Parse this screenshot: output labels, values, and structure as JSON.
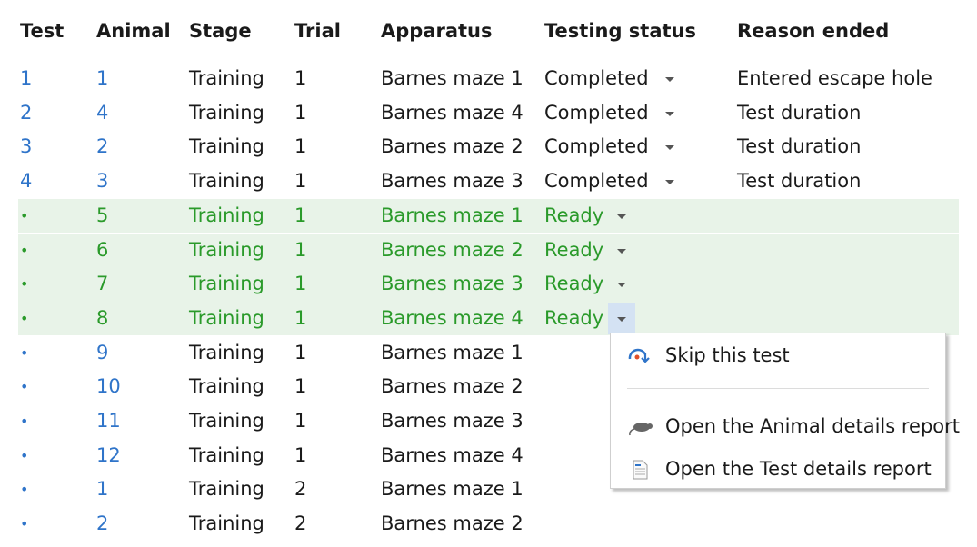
{
  "columns": [
    "Test",
    "Animal",
    "Stage",
    "Trial",
    "Apparatus",
    "Testing status",
    "Reason ended"
  ],
  "rows": [
    {
      "test": "1",
      "animal": "1",
      "stage": "Training",
      "trial": "1",
      "apparatus": "Barnes maze 1",
      "status": "Completed",
      "reason": "Entered escape hole",
      "state": "completed"
    },
    {
      "test": "2",
      "animal": "4",
      "stage": "Training",
      "trial": "1",
      "apparatus": "Barnes maze 4",
      "status": "Completed",
      "reason": "Test duration",
      "state": "completed"
    },
    {
      "test": "3",
      "animal": "2",
      "stage": "Training",
      "trial": "1",
      "apparatus": "Barnes maze 2",
      "status": "Completed",
      "reason": "Test duration",
      "state": "completed"
    },
    {
      "test": "4",
      "animal": "3",
      "stage": "Training",
      "trial": "1",
      "apparatus": "Barnes maze 3",
      "status": "Completed",
      "reason": "Test duration",
      "state": "completed"
    },
    {
      "test": "•",
      "animal": "5",
      "stage": "Training",
      "trial": "1",
      "apparatus": "Barnes maze 1",
      "status": "Ready",
      "reason": "",
      "state": "ready"
    },
    {
      "test": "•",
      "animal": "6",
      "stage": "Training",
      "trial": "1",
      "apparatus": "Barnes maze 2",
      "status": "Ready",
      "reason": "",
      "state": "ready"
    },
    {
      "test": "•",
      "animal": "7",
      "stage": "Training",
      "trial": "1",
      "apparatus": "Barnes maze 3",
      "status": "Ready",
      "reason": "",
      "state": "ready"
    },
    {
      "test": "•",
      "animal": "8",
      "stage": "Training",
      "trial": "1",
      "apparatus": "Barnes maze 4",
      "status": "Ready",
      "reason": "",
      "state": "ready",
      "menu_open": true
    },
    {
      "test": "•",
      "animal": "9",
      "stage": "Training",
      "trial": "1",
      "apparatus": "Barnes maze 1",
      "status": "",
      "reason": "",
      "state": "pending"
    },
    {
      "test": "•",
      "animal": "10",
      "stage": "Training",
      "trial": "1",
      "apparatus": "Barnes maze 2",
      "status": "",
      "reason": "",
      "state": "pending"
    },
    {
      "test": "•",
      "animal": "11",
      "stage": "Training",
      "trial": "1",
      "apparatus": "Barnes maze 3",
      "status": "",
      "reason": "",
      "state": "pending"
    },
    {
      "test": "•",
      "animal": "12",
      "stage": "Training",
      "trial": "1",
      "apparatus": "Barnes maze 4",
      "status": "",
      "reason": "",
      "state": "pending"
    },
    {
      "test": "•",
      "animal": "1",
      "stage": "Training",
      "trial": "2",
      "apparatus": "Barnes maze 1",
      "status": "",
      "reason": "",
      "state": "pending"
    },
    {
      "test": "•",
      "animal": "2",
      "stage": "Training",
      "trial": "2",
      "apparatus": "Barnes maze 2",
      "status": "",
      "reason": "",
      "state": "pending"
    }
  ],
  "context_menu": {
    "items": [
      {
        "label": "Skip this test",
        "icon": "skip-icon"
      },
      {
        "label": "Open the Animal details report",
        "icon": "animal-icon"
      },
      {
        "label": "Open the Test details report",
        "icon": "document-icon"
      }
    ]
  },
  "colors": {
    "link": "#2f74c9",
    "ready_text": "#2a9a2a",
    "ready_bg": "#e8f3e8",
    "dropdown_active": "#d4e2f3"
  }
}
